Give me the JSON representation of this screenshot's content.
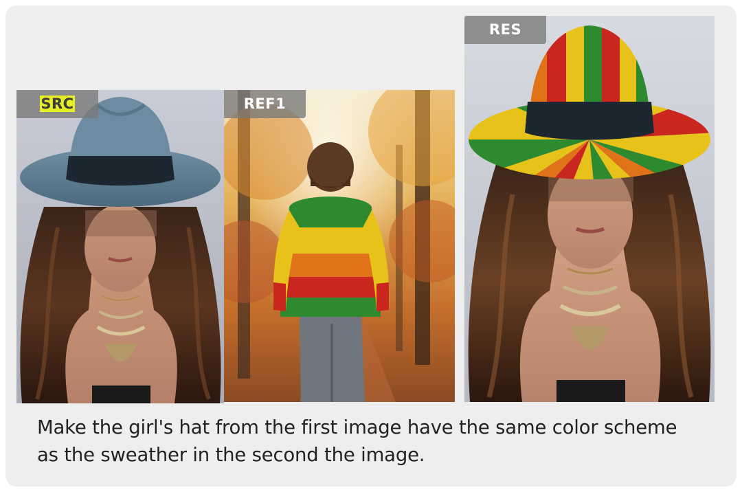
{
  "panels": {
    "src": {
      "label": "SRC",
      "description": "portrait with slate-blue fedora"
    },
    "ref": {
      "label": "REF1",
      "description": "person in striped sweater walking in autumn forest"
    },
    "res": {
      "label": "RES",
      "description": "portrait with striped multicolor fedora"
    }
  },
  "colors": {
    "card_background": "#eeeeee",
    "label_background": "#787878",
    "label_highlight": "#e6ee2a",
    "hat_blue": "#5e7d90",
    "stripe_green": "#2e8a2e",
    "stripe_yellow": "#e7c21a",
    "stripe_orange": "#e0731a",
    "stripe_red": "#c8261f"
  },
  "instruction": {
    "line1": "Make the girl's hat from the first image have the same color scheme",
    "line2": "as the sweather in the second the image."
  }
}
